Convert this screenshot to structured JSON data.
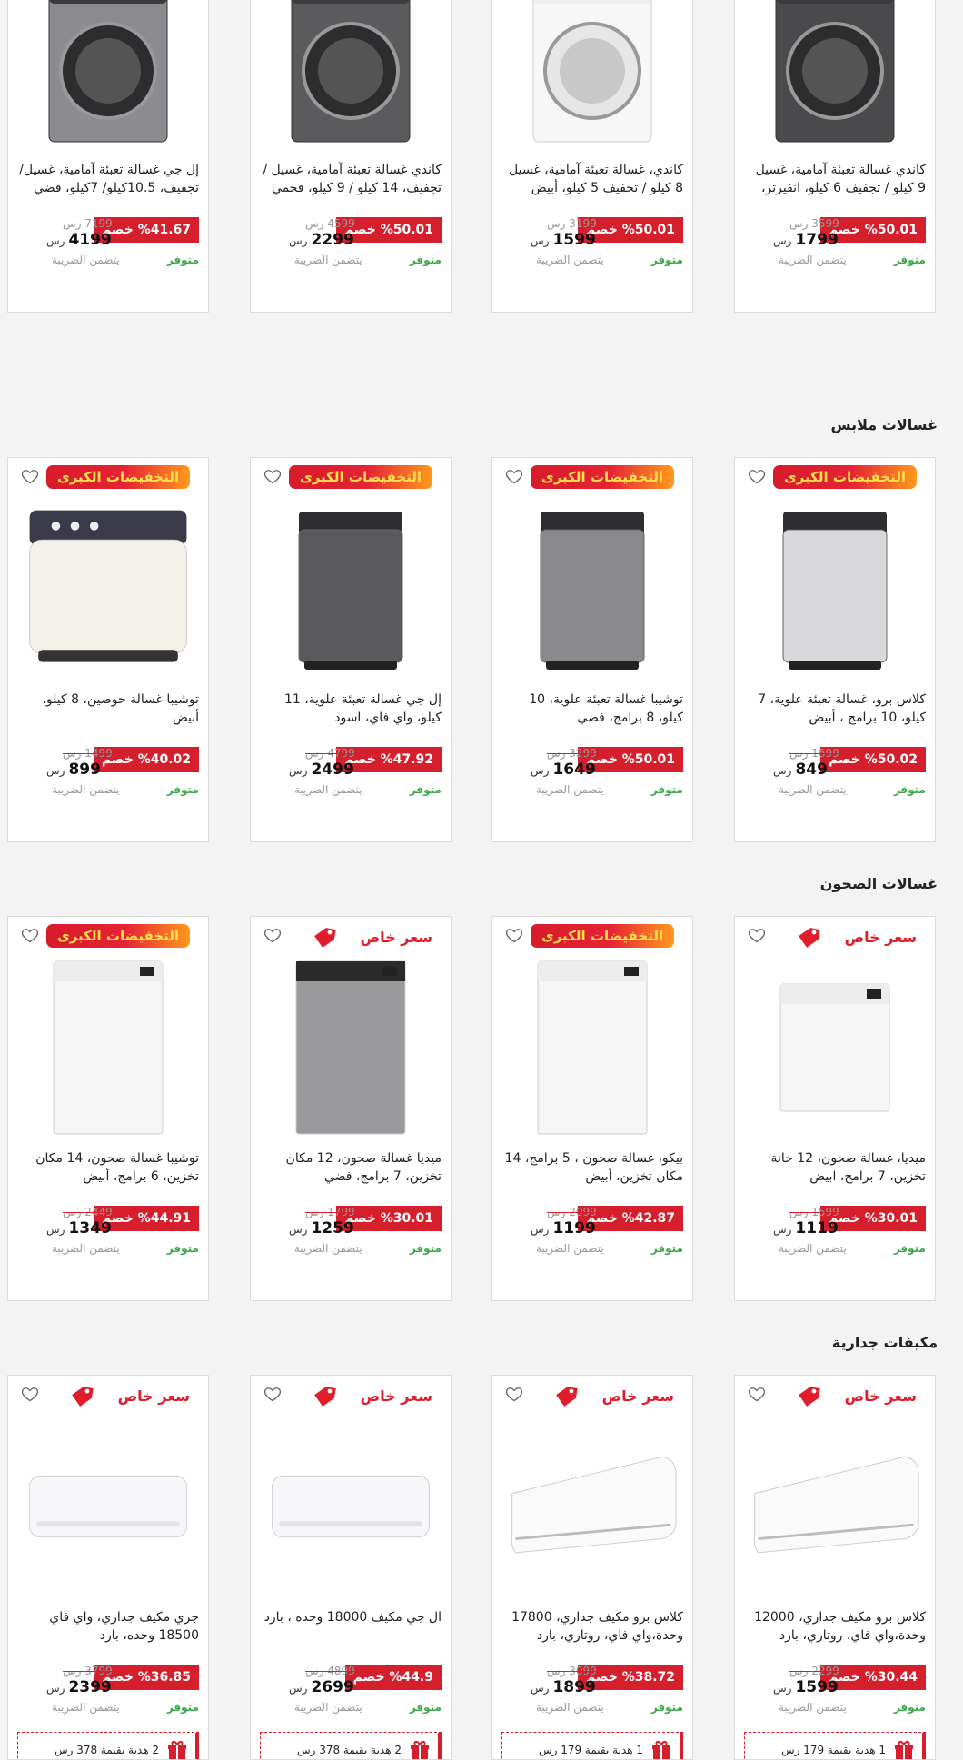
{
  "labels": {
    "special": "سعر خاص",
    "mega": "التخفيضات الكبرى",
    "discount_suffix": "خصم",
    "currency": "رس",
    "in_stock": "متوفر",
    "tax_included": "يتضمن الضريبة"
  },
  "colors": {
    "accent": "#d61f2c",
    "stock": "#3aa84a",
    "sale_gradient_end": "#ff9a1e"
  },
  "sections": [
    {
      "title": "",
      "products": [
        {
          "badge": "mega",
          "name": "كاندي غسالة تعبئة آمامية، غسيل 9 كيلو / تجفيف 6 كيلو، انفيرتر، فحمي",
          "discount": "%50.01",
          "old": "3599 رس",
          "price": "1799",
          "image": "washer-dark"
        },
        {
          "badge": "special",
          "name": "كاندي، غسالة تعبئة آمامية، غسيل 8 كيلو / تجفيف 5 كيلو، أبيض",
          "discount": "%50.01",
          "old": "3199 رس",
          "price": "1599",
          "image": "washer-white"
        },
        {
          "badge": "mega",
          "name": "كاندي غسالة تعبئة آمامية، غسيل / تجفيف، 14 كيلو / 9 كيلو، فحمي",
          "discount": "%50.01",
          "old": "4599 رس",
          "price": "2299",
          "image": "washer-grey"
        },
        {
          "badge": "special",
          "name": "إل جي غسالة تعبئة آمامية، غسيل/ تجفيف، 10.5كيلو/ 7كيلو، فضي",
          "discount": "%41.67",
          "old": "7199 رس",
          "price": "4199",
          "image": "washer-silver"
        }
      ]
    },
    {
      "title": "غسالات ملابس",
      "products": [
        {
          "badge": "mega",
          "name": "كلاس برو، غسالة تعبئة علوية، 7 كيلو، 10 برامج ، أبيض",
          "discount": "%50.02",
          "old": "1699 رس",
          "price": "849",
          "image": "toploader-white"
        },
        {
          "badge": "mega",
          "name": "توشيبا غسالة تعبئة علوية، 10 كيلو، 8 برامج، فضي",
          "discount": "%50.01",
          "old": "3299 رس",
          "price": "1649",
          "image": "toploader-grey"
        },
        {
          "badge": "mega",
          "name": "إل جي غسالة تعبئة علوية، 11 كيلو، واي فاي، اسود",
          "discount": "%47.92",
          "old": "4799 رس",
          "price": "2499",
          "image": "toploader-dark"
        },
        {
          "badge": "mega",
          "name": "توشيبا غسالة حوضين، 8 كيلو، أبيض",
          "discount": "%40.02",
          "old": "1499 رس",
          "price": "899",
          "image": "twintub"
        }
      ]
    },
    {
      "title": "غسالات الصحون",
      "products": [
        {
          "badge": "special",
          "name": "ميديا، غسالة صحون، 12 خانة تخزين، 7 برامج، ابيض",
          "discount": "%30.01",
          "old": "1599 رس",
          "price": "1119",
          "image": "dish-white-small"
        },
        {
          "badge": "mega",
          "name": "بيكو، غسالة صحون ، 5 برامج، 14 مكان تخزين، أبيض",
          "discount": "%42.87",
          "old": "2099 رس",
          "price": "1199",
          "image": "dish-white"
        },
        {
          "badge": "special",
          "name": "ميديا غسالة صحون، 12 مكان تخزين، 7 برامج، فضي",
          "discount": "%30.01",
          "old": "1799 رس",
          "price": "1259",
          "image": "dish-silver"
        },
        {
          "badge": "mega",
          "name": "توشيبا غسالة صحون، 14 مكان تخزين، 6 برامج، أبيض",
          "discount": "%44.91",
          "old": "2449 رس",
          "price": "1349",
          "image": "dish-white-2"
        }
      ]
    },
    {
      "title": "مكيفات جدارية",
      "products": [
        {
          "badge": "special",
          "name": "كلاس برو مكيف جداري، 12000 وحدة،واي فاي، روتاري، بارد",
          "discount": "%30.44",
          "old": "2299 رس",
          "price": "1599",
          "image": "ac-big",
          "gift": "1 هدية بقيمة 179 رس"
        },
        {
          "badge": "special",
          "name": "كلاس برو مكيف جداري، 17800 وحدة،واي فاي، روتاري، بارد",
          "discount": "%38.72",
          "old": "3099 رس",
          "price": "1899",
          "image": "ac-big",
          "gift": "1 هدية بقيمة 179 رس"
        },
        {
          "badge": "special",
          "name": "ال جي مكيف 18000 وحده ، بارد",
          "discount": "%44.9",
          "old": "4899 رس",
          "price": "2699",
          "image": "ac-slim",
          "gift": "2 هدية بقيمة 378 رس"
        },
        {
          "badge": "special",
          "name": "جري مكيف جداري، واي فاي 18500 وحده، بارد",
          "discount": "%36.85",
          "old": "3799 رس",
          "price": "2399",
          "image": "ac-slim-2",
          "gift": "2 هدية بقيمة 378 رس"
        }
      ]
    }
  ]
}
